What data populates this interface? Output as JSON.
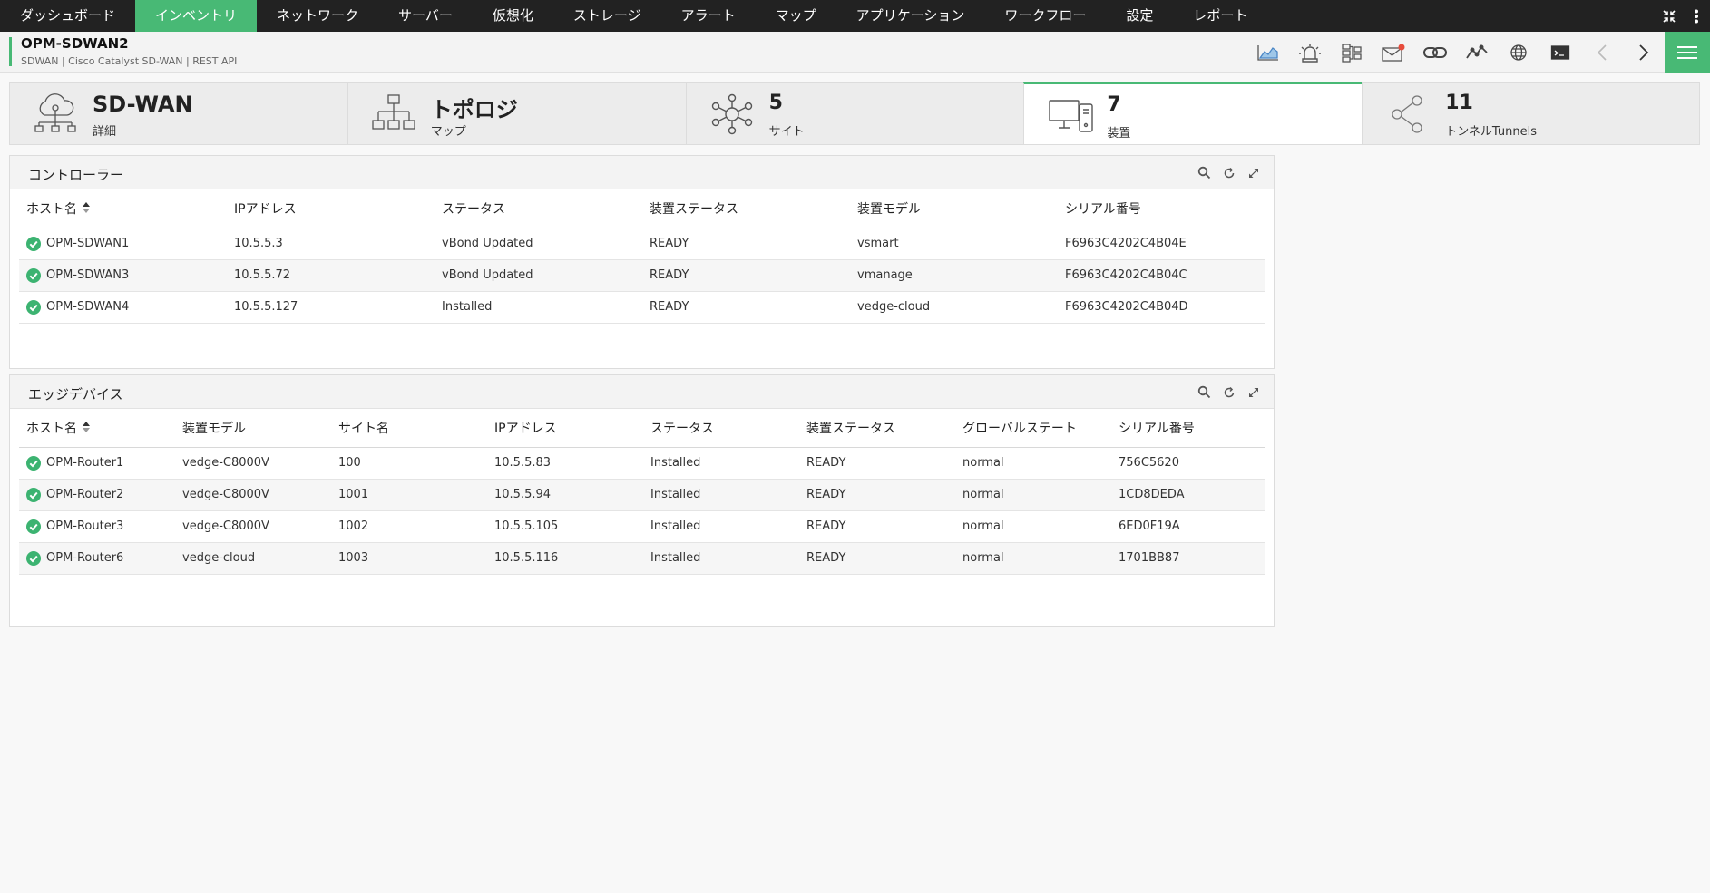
{
  "nav": {
    "items": [
      "ダッシュボード",
      "インベントリ",
      "ネットワーク",
      "サーバー",
      "仮想化",
      "ストレージ",
      "アラート",
      "マップ",
      "アプリケーション",
      "ワークフロー",
      "設定",
      "レポート"
    ],
    "active_index": 1
  },
  "header": {
    "title": "OPM-SDWAN2",
    "subtitle": "SDWAN | Cisco Catalyst SD-WAN  | REST API"
  },
  "cards": [
    {
      "value": "SD-WAN",
      "label": "詳細",
      "icon": "cloud-network-icon"
    },
    {
      "value": "トポロジ",
      "label": "マップ",
      "icon": "topology-icon"
    },
    {
      "value": "5",
      "label": "サイト",
      "icon": "hub-sites-icon"
    },
    {
      "value": "7",
      "label": "装置",
      "icon": "devices-icon"
    },
    {
      "value": "11",
      "label": "トンネルTunnels",
      "icon": "share-tunnels-icon"
    }
  ],
  "controllers": {
    "title": "コントローラー",
    "columns": [
      "ホスト名",
      "IPアドレス",
      "ステータス",
      "装置ステータス",
      "装置モデル",
      "シリアル番号"
    ],
    "rows": [
      [
        "OPM-SDWAN1",
        "10.5.5.3",
        "vBond Updated",
        "READY",
        "vsmart",
        "F6963C4202C4B04E"
      ],
      [
        "OPM-SDWAN3",
        "10.5.5.72",
        "vBond Updated",
        "READY",
        "vmanage",
        "F6963C4202C4B04C"
      ],
      [
        "OPM-SDWAN4",
        "10.5.5.127",
        "Installed",
        "READY",
        "vedge-cloud",
        "F6963C4202C4B04D"
      ]
    ]
  },
  "edges": {
    "title": "エッジデバイス",
    "columns": [
      "ホスト名",
      "装置モデル",
      "サイト名",
      "IPアドレス",
      "ステータス",
      "装置ステータス",
      "グローバルステート",
      "シリアル番号"
    ],
    "rows": [
      [
        "OPM-Router1",
        "vedge-C8000V",
        "100",
        "10.5.5.83",
        "Installed",
        "READY",
        "normal",
        "756C5620"
      ],
      [
        "OPM-Router2",
        "vedge-C8000V",
        "1001",
        "10.5.5.94",
        "Installed",
        "READY",
        "normal",
        "1CD8DEDA"
      ],
      [
        "OPM-Router3",
        "vedge-C8000V",
        "1002",
        "10.5.5.105",
        "Installed",
        "READY",
        "normal",
        "6ED0F19A"
      ],
      [
        "OPM-Router6",
        "vedge-cloud",
        "1003",
        "10.5.5.116",
        "Installed",
        "READY",
        "normal",
        "1701BB87"
      ]
    ]
  },
  "colors": {
    "accent": "#48b975",
    "nav_bg": "#222222",
    "status_ok": "#3cb371",
    "alert_dot": "#e74c3c"
  }
}
